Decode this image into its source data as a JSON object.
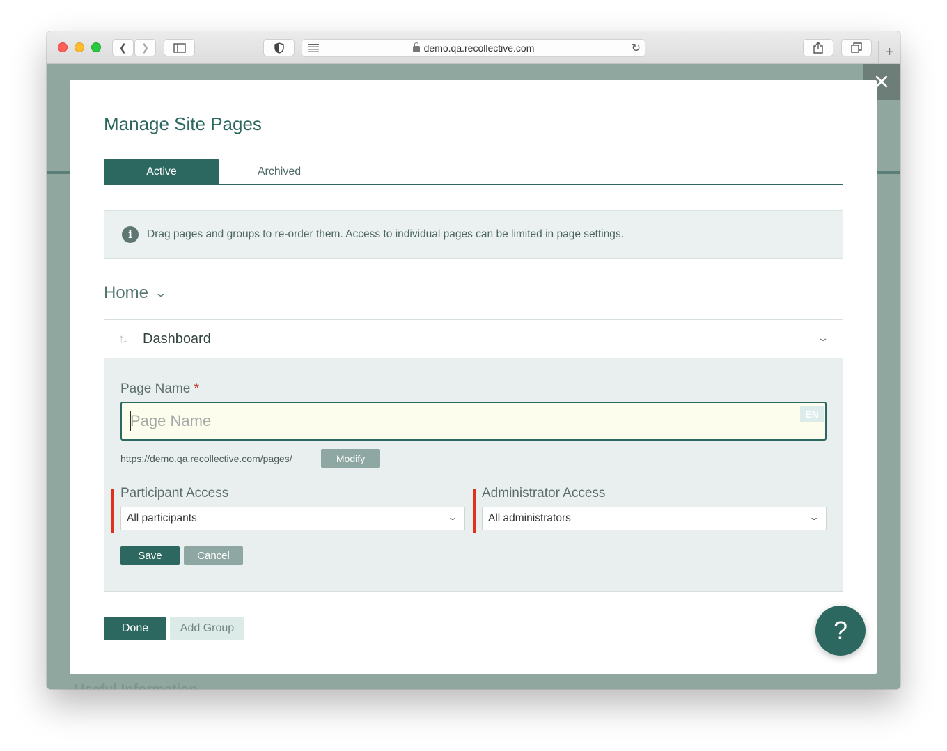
{
  "browser": {
    "url": "demo.qa.recollective.com",
    "plus_tab": "+"
  },
  "background": {
    "ghost_text": "Useful Information"
  },
  "modal": {
    "title": "Manage Site Pages",
    "close_glyph": "✕",
    "tabs": [
      {
        "label": "Active",
        "selected": true
      },
      {
        "label": "Archived",
        "selected": false
      }
    ],
    "info_message": "Drag pages and groups to re-order them. Access to individual pages can be limited in page settings.",
    "group": {
      "title": "Home"
    },
    "page": {
      "title": "Dashboard",
      "page_name_label": "Page Name",
      "required_mark": "*",
      "page_name_value": "",
      "page_name_placeholder": "Page Name",
      "language_badge": "EN",
      "url_prefix": "https://demo.qa.recollective.com/pages/",
      "modify_label": "Modify",
      "participant_access_label": "Participant Access",
      "participant_access_value": "All participants",
      "administrator_access_label": "Administrator Access",
      "administrator_access_value": "All administrators",
      "save_label": "Save",
      "cancel_label": "Cancel"
    },
    "done_label": "Done",
    "add_group_label": "Add Group",
    "help_glyph": "?"
  },
  "colors": {
    "accent": "#2c6860",
    "secondary_button": "#8ea7a2",
    "required": "#c0392b",
    "access_marker": "#e0301e"
  }
}
